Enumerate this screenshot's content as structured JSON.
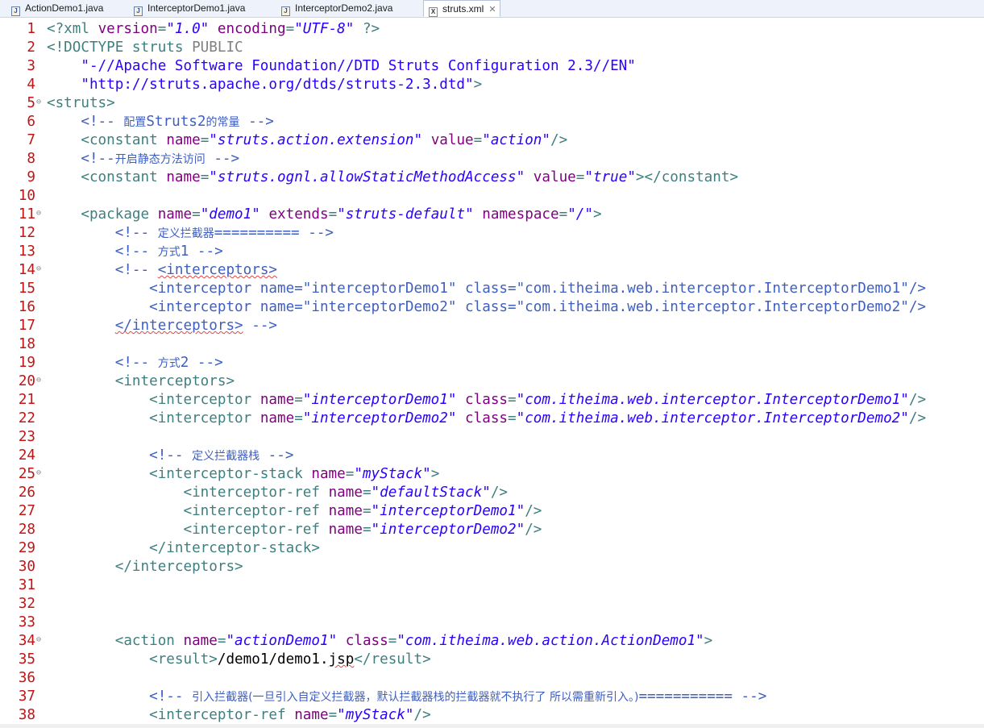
{
  "tabs": [
    {
      "label": "ActionDemo1.java",
      "icon": "java-file-icon"
    },
    {
      "label": "InterceptorDemo1.java",
      "icon": "java-file-icon"
    },
    {
      "label": "InterceptorDemo2.java",
      "icon": "java-file-icon"
    },
    {
      "label": "struts.xml",
      "icon": "xml-file-icon",
      "active": true,
      "close": "✕"
    }
  ],
  "editor": {
    "lines": [
      {
        "n": 1,
        "tokens": [
          [
            "t",
            "<?xml "
          ],
          [
            "n",
            "version"
          ],
          [
            "t",
            "="
          ],
          [
            "v",
            "\"1.0\""
          ],
          [
            "t",
            " "
          ],
          [
            "n",
            "encoding"
          ],
          [
            "t",
            "="
          ],
          [
            "v",
            "\"UTF-8\""
          ],
          [
            "t",
            " ?>"
          ]
        ]
      },
      {
        "n": 2,
        "tokens": [
          [
            "t",
            "<!DOCTYPE struts "
          ],
          [
            "dt",
            "PUBLIC"
          ]
        ]
      },
      {
        "n": 3,
        "tokens": [
          [
            "vp",
            "    \"-//Apache Software Foundation//DTD Struts Configuration 2.3//EN\""
          ]
        ]
      },
      {
        "n": 4,
        "tokens": [
          [
            "vp",
            "    \"http://struts.apache.org/dtds/struts-2.3.dtd\""
          ],
          [
            "t",
            ">"
          ]
        ]
      },
      {
        "n": 5,
        "fold": true,
        "tokens": [
          [
            "t",
            "<struts>"
          ]
        ]
      },
      {
        "n": 6,
        "tokens": [
          [
            "tx",
            "    "
          ],
          [
            "c",
            "<!-- "
          ],
          [
            "cz",
            "配置"
          ],
          [
            "c",
            "Struts2"
          ],
          [
            "cz",
            "的常量"
          ],
          [
            "c",
            " -->"
          ]
        ]
      },
      {
        "n": 7,
        "tokens": [
          [
            "tx",
            "    "
          ],
          [
            "t",
            "<constant "
          ],
          [
            "n",
            "name"
          ],
          [
            "t",
            "="
          ],
          [
            "v",
            "\"struts.action.extension\""
          ],
          [
            "t",
            " "
          ],
          [
            "n",
            "value"
          ],
          [
            "t",
            "="
          ],
          [
            "v",
            "\"action\""
          ],
          [
            "t",
            "/>"
          ]
        ]
      },
      {
        "n": 8,
        "tokens": [
          [
            "tx",
            "    "
          ],
          [
            "c",
            "<!--"
          ],
          [
            "cz",
            "开启静态方法访问"
          ],
          [
            "c",
            " -->"
          ]
        ]
      },
      {
        "n": 9,
        "tokens": [
          [
            "tx",
            "    "
          ],
          [
            "t",
            "<constant "
          ],
          [
            "n",
            "name"
          ],
          [
            "t",
            "="
          ],
          [
            "v",
            "\"struts.ognl.allowStaticMethodAccess\""
          ],
          [
            "t",
            " "
          ],
          [
            "n",
            "value"
          ],
          [
            "t",
            "="
          ],
          [
            "v",
            "\"true\""
          ],
          [
            "t",
            "></constant>"
          ]
        ]
      },
      {
        "n": 10,
        "tokens": []
      },
      {
        "n": 11,
        "fold": true,
        "tokens": [
          [
            "tx",
            "    "
          ],
          [
            "t",
            "<package "
          ],
          [
            "n",
            "name"
          ],
          [
            "t",
            "="
          ],
          [
            "v",
            "\"demo1\""
          ],
          [
            "t",
            " "
          ],
          [
            "n",
            "extends"
          ],
          [
            "t",
            "="
          ],
          [
            "v",
            "\"struts-default\""
          ],
          [
            "t",
            " "
          ],
          [
            "n",
            "namespace"
          ],
          [
            "t",
            "="
          ],
          [
            "v",
            "\"/\""
          ],
          [
            "t",
            ">"
          ]
        ]
      },
      {
        "n": 12,
        "tokens": [
          [
            "tx",
            "        "
          ],
          [
            "c",
            "<!-- "
          ],
          [
            "cz",
            "定义拦截器"
          ],
          [
            "c",
            "========== -->"
          ]
        ]
      },
      {
        "n": 13,
        "tokens": [
          [
            "tx",
            "        "
          ],
          [
            "c",
            "<!-- "
          ],
          [
            "cz",
            "方式"
          ],
          [
            "c",
            "1 -->"
          ]
        ]
      },
      {
        "n": 14,
        "fold": true,
        "tokens": [
          [
            "tx",
            "        "
          ],
          [
            "c",
            "<!-- "
          ],
          [
            "csq",
            "<interceptors>"
          ]
        ]
      },
      {
        "n": 15,
        "tokens": [
          [
            "c",
            "            <interceptor name=\"interceptorDemo1\" class=\"com.itheima.web.interceptor.InterceptorDemo1\"/>"
          ]
        ]
      },
      {
        "n": 16,
        "tokens": [
          [
            "c",
            "            <interceptor name=\"interceptorDemo2\" class=\"com.itheima.web.interceptor.InterceptorDemo2\"/>"
          ]
        ]
      },
      {
        "n": 17,
        "tokens": [
          [
            "tx",
            "        "
          ],
          [
            "csq",
            "</interceptors>"
          ],
          [
            "c",
            " -->"
          ]
        ]
      },
      {
        "n": 18,
        "tokens": []
      },
      {
        "n": 19,
        "tokens": [
          [
            "tx",
            "        "
          ],
          [
            "c",
            "<!-- "
          ],
          [
            "cz",
            "方式"
          ],
          [
            "c",
            "2 -->"
          ]
        ]
      },
      {
        "n": 20,
        "fold": true,
        "tokens": [
          [
            "tx",
            "        "
          ],
          [
            "t",
            "<interceptors>"
          ]
        ]
      },
      {
        "n": 21,
        "tokens": [
          [
            "tx",
            "            "
          ],
          [
            "t",
            "<interceptor "
          ],
          [
            "n",
            "name"
          ],
          [
            "t",
            "="
          ],
          [
            "v",
            "\"interceptorDemo1\""
          ],
          [
            "t",
            " "
          ],
          [
            "n",
            "class"
          ],
          [
            "t",
            "="
          ],
          [
            "v",
            "\"com.itheima.web.interceptor.InterceptorDemo1\""
          ],
          [
            "t",
            "/>"
          ]
        ]
      },
      {
        "n": 22,
        "tokens": [
          [
            "tx",
            "            "
          ],
          [
            "t",
            "<interceptor "
          ],
          [
            "n",
            "name"
          ],
          [
            "t",
            "="
          ],
          [
            "v",
            "\"interceptorDemo2\""
          ],
          [
            "t",
            " "
          ],
          [
            "n",
            "class"
          ],
          [
            "t",
            "="
          ],
          [
            "v",
            "\"com.itheima.web.interceptor.InterceptorDemo2\""
          ],
          [
            "t",
            "/>"
          ]
        ]
      },
      {
        "n": 23,
        "tokens": []
      },
      {
        "n": 24,
        "tokens": [
          [
            "tx",
            "            "
          ],
          [
            "c",
            "<!-- "
          ],
          [
            "cz",
            "定义拦截器栈"
          ],
          [
            "c",
            " -->"
          ]
        ]
      },
      {
        "n": 25,
        "fold": true,
        "tokens": [
          [
            "tx",
            "            "
          ],
          [
            "t",
            "<interceptor-stack "
          ],
          [
            "n",
            "name"
          ],
          [
            "t",
            "="
          ],
          [
            "v",
            "\"myStack\""
          ],
          [
            "t",
            ">"
          ]
        ]
      },
      {
        "n": 26,
        "tokens": [
          [
            "tx",
            "                "
          ],
          [
            "t",
            "<interceptor-ref "
          ],
          [
            "n",
            "name"
          ],
          [
            "t",
            "="
          ],
          [
            "v",
            "\"defaultStack\""
          ],
          [
            "t",
            "/>"
          ]
        ]
      },
      {
        "n": 27,
        "tokens": [
          [
            "tx",
            "                "
          ],
          [
            "t",
            "<interceptor-ref "
          ],
          [
            "n",
            "name"
          ],
          [
            "t",
            "="
          ],
          [
            "v",
            "\"interceptorDemo1\""
          ],
          [
            "t",
            "/>"
          ]
        ]
      },
      {
        "n": 28,
        "tokens": [
          [
            "tx",
            "                "
          ],
          [
            "t",
            "<interceptor-ref "
          ],
          [
            "n",
            "name"
          ],
          [
            "t",
            "="
          ],
          [
            "v",
            "\"interceptorDemo2\""
          ],
          [
            "t",
            "/>"
          ]
        ]
      },
      {
        "n": 29,
        "tokens": [
          [
            "tx",
            "            "
          ],
          [
            "t",
            "</interceptor-stack>"
          ]
        ]
      },
      {
        "n": 30,
        "tokens": [
          [
            "tx",
            "        "
          ],
          [
            "t",
            "</interceptors>"
          ]
        ]
      },
      {
        "n": 31,
        "tokens": []
      },
      {
        "n": 32,
        "tokens": []
      },
      {
        "n": 33,
        "tokens": []
      },
      {
        "n": 34,
        "fold": true,
        "tokens": [
          [
            "tx",
            "        "
          ],
          [
            "t",
            "<action "
          ],
          [
            "n",
            "name"
          ],
          [
            "t",
            "="
          ],
          [
            "v",
            "\"actionDemo1\""
          ],
          [
            "t",
            " "
          ],
          [
            "n",
            "class"
          ],
          [
            "t",
            "="
          ],
          [
            "v",
            "\"com.itheima.web.action.ActionDemo1\""
          ],
          [
            "t",
            ">"
          ]
        ]
      },
      {
        "n": 35,
        "tokens": [
          [
            "tx",
            "            "
          ],
          [
            "t",
            "<result>"
          ],
          [
            "tx",
            "/demo1/demo1."
          ],
          [
            "txsq",
            "jsp"
          ],
          [
            "t",
            "</result>"
          ]
        ]
      },
      {
        "n": 36,
        "tokens": []
      },
      {
        "n": 37,
        "tokens": [
          [
            "tx",
            "            "
          ],
          [
            "c",
            "<!-- "
          ],
          [
            "cz",
            "引入拦截器(一旦引入自定义拦截器，默认拦截器栈的拦截器就不执行了 所以需重新引入。)"
          ],
          [
            "c",
            "=========== -->"
          ]
        ]
      },
      {
        "n": 38,
        "tokens": [
          [
            "tx",
            "            "
          ],
          [
            "t",
            "<interceptor-ref "
          ],
          [
            "n",
            "name"
          ],
          [
            "t",
            "="
          ],
          [
            "v",
            "\"myStack\""
          ],
          [
            "t",
            "/>"
          ]
        ]
      }
    ]
  }
}
